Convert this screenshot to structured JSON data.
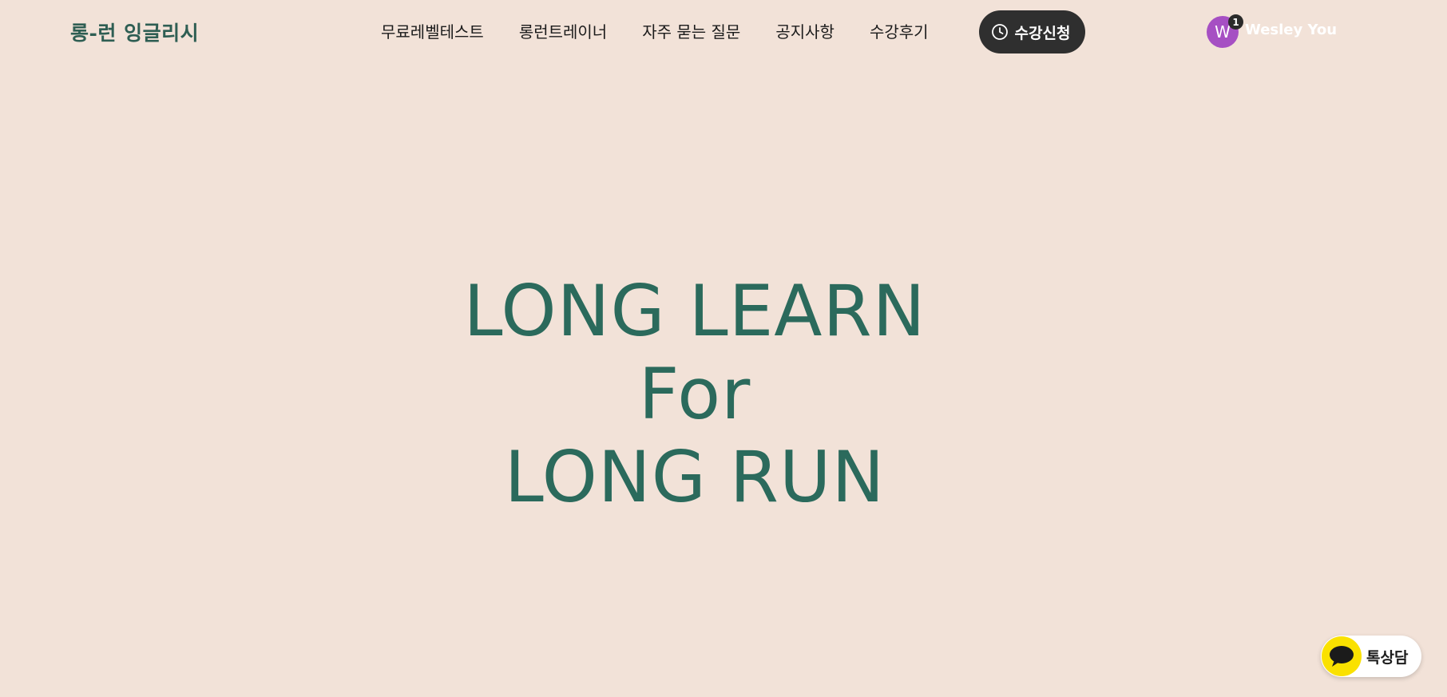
{
  "header": {
    "logo": "롱-런 잉글리시",
    "nav": [
      {
        "label": "무료레벨테스트"
      },
      {
        "label": "롱런트레이너"
      },
      {
        "label": "자주 묻는 질문"
      },
      {
        "label": "공지사항"
      },
      {
        "label": "수강후기"
      }
    ],
    "cta_label": "수강신청",
    "cta_icon": "clock-icon",
    "user": {
      "initial": "W",
      "notification_count": "1",
      "name": "Wesley You",
      "avatar_color": "#a64fc3"
    }
  },
  "hero": {
    "lines": [
      "LONG LEARN",
      "For",
      "LONG RUN"
    ]
  },
  "chat_widget": {
    "label": "톡상담",
    "icon": "kakao-chat-icon",
    "color": "#fae100"
  },
  "colors": {
    "background": "#f2e2d8",
    "brand_green": "#2b6a5c",
    "cta_background": "#2f2f2f"
  }
}
